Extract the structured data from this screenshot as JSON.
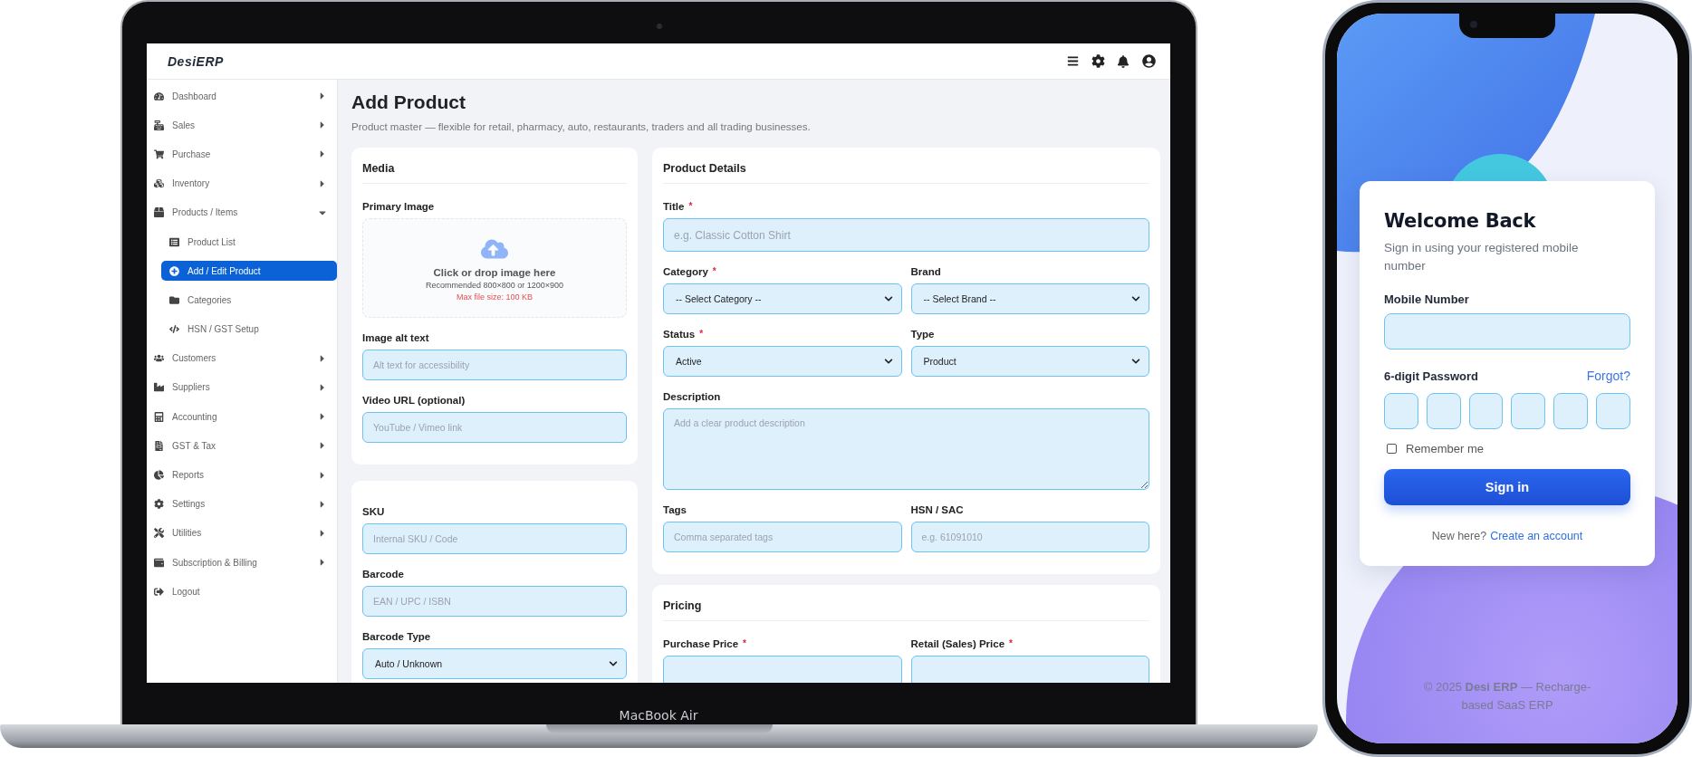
{
  "laptop": {
    "label": "MacBook Air",
    "app": {
      "brand": "DesiERP",
      "sidebar": {
        "items": [
          {
            "label": "Dashboard",
            "selected": false,
            "expanded": false
          },
          {
            "label": "Sales",
            "selected": false,
            "expanded": false
          },
          {
            "label": "Purchase",
            "selected": false,
            "expanded": false
          },
          {
            "label": "Inventory",
            "selected": false,
            "expanded": false
          },
          {
            "label": "Products / Items",
            "selected": false,
            "expanded": true,
            "children": [
              {
                "label": "Product List",
                "selected": false
              },
              {
                "label": "Add / Edit Product",
                "selected": true
              },
              {
                "label": "Categories",
                "selected": false
              },
              {
                "label": "HSN / GST Setup",
                "selected": false
              }
            ]
          },
          {
            "label": "Customers",
            "selected": false,
            "expanded": false
          },
          {
            "label": "Suppliers",
            "selected": false,
            "expanded": false
          },
          {
            "label": "Accounting",
            "selected": false,
            "expanded": false
          },
          {
            "label": "GST & Tax",
            "selected": false,
            "expanded": false
          },
          {
            "label": "Reports",
            "selected": false,
            "expanded": false
          },
          {
            "label": "Settings",
            "selected": false,
            "expanded": false
          },
          {
            "label": "Utilities",
            "selected": false,
            "expanded": false
          },
          {
            "label": "Subscription & Billing",
            "selected": false,
            "expanded": false
          },
          {
            "label": "Logout",
            "selected": false
          }
        ]
      },
      "page": {
        "title": "Add Product",
        "subtitle": "Product master — flexible for retail, pharmacy, auto, restaurants, traders and all trading businesses."
      },
      "left_cards": [
        {
          "title": "Media",
          "rows": [
            [
              {
                "kind": "dropzone",
                "label": "Primary Image",
                "text": "Click or drop image here",
                "hint": "Recommended 800×800 or 1200×900",
                "limit": "Max file size: 100 KB"
              }
            ],
            [
              {
                "kind": "text",
                "label": "Image alt text",
                "placeholder": "Alt text for accessibility"
              }
            ],
            [
              {
                "kind": "text",
                "label": "Video URL (optional)",
                "placeholder": "YouTube / Vimeo link"
              }
            ]
          ]
        },
        {
          "rows": [
            [
              {
                "kind": "text",
                "label": "SKU",
                "placeholder": "Internal SKU / Code"
              }
            ],
            [
              {
                "kind": "text",
                "label": "Barcode",
                "placeholder": "EAN / UPC / ISBN"
              }
            ],
            [
              {
                "kind": "select",
                "label": "Barcode Type",
                "value": "Auto / Unknown"
              }
            ]
          ]
        }
      ],
      "right_cards": [
        {
          "title": "Product Details",
          "rows": [
            [
              {
                "kind": "text",
                "label": "Title",
                "placeholder": "e.g. Classic Cotton Shirt",
                "required_mark": "*"
              }
            ],
            [
              {
                "kind": "select",
                "label": "Category",
                "value": "-- Select Category --",
                "required_mark": "*"
              },
              {
                "kind": "select",
                "label": "Brand",
                "value": "-- Select Brand --"
              }
            ],
            [
              {
                "kind": "select",
                "label": "Status",
                "value": "Active",
                "required_mark": "*"
              },
              {
                "kind": "select",
                "label": "Type",
                "value": "Product"
              }
            ],
            [
              {
                "kind": "textarea",
                "label": "Description",
                "placeholder": "Add a clear product description"
              }
            ],
            [
              {
                "kind": "text",
                "label": "Tags",
                "placeholder": "Comma separated tags"
              },
              {
                "kind": "text",
                "label": "HSN / SAC",
                "placeholder": "e.g. 61091010"
              }
            ]
          ]
        },
        {
          "title": "Pricing",
          "rows": [
            [
              {
                "kind": "text",
                "label": "Purchase Price",
                "required_mark": "*"
              },
              {
                "kind": "text",
                "label": "Retail (Sales) Price",
                "required_mark": "*"
              }
            ]
          ]
        }
      ]
    }
  },
  "phone": {
    "title": "Welcome Back",
    "subtitle": "Sign in using your registered mobile number",
    "mobile_label": "Mobile Number",
    "password_label": "6-digit Password",
    "forgot_link": "Forgot?",
    "pin_boxes": [
      {
        "filled": false
      },
      {
        "filled": false
      },
      {
        "filled": false
      },
      {
        "filled": false
      },
      {
        "filled": false
      },
      {
        "filled": false
      }
    ],
    "remember": {
      "label": "Remember me",
      "checked": false
    },
    "button": "Sign in",
    "signup_prompt": "New here?",
    "signup_link": "Create an account",
    "footer": "© 2025 **Desi ERP** — Recharge-based SaaS ERP"
  }
}
